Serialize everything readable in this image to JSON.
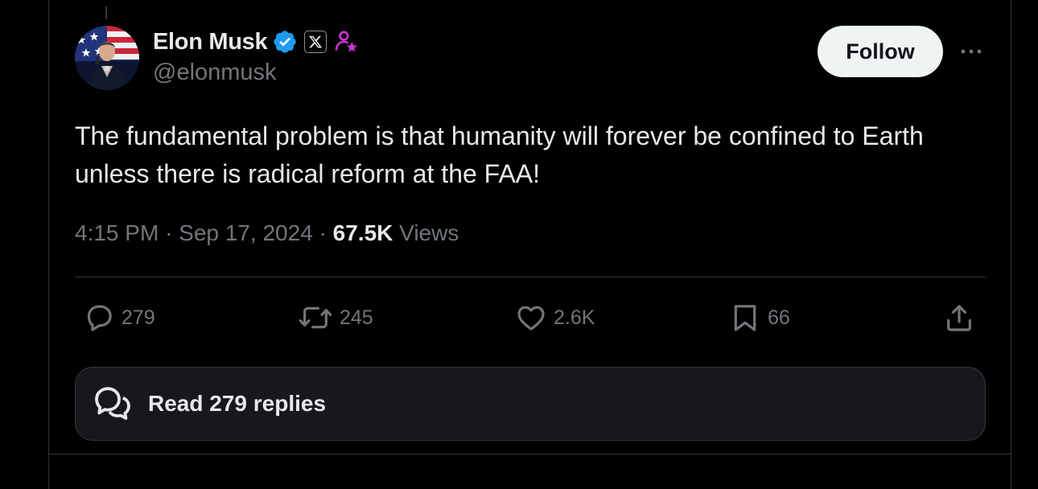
{
  "author": {
    "display_name": "Elon Musk",
    "handle": "@elonmusk",
    "verified": true,
    "verified_color": "#1d9bf0",
    "affiliate_icon": "x-logo-icon",
    "pro_icon_color": "#c936cf"
  },
  "follow_button": {
    "label": "Follow"
  },
  "tweet": {
    "text": "The fundamental problem is that humanity will forever be confined to Earth unless there is radical reform at the FAA!",
    "time": "4:15 PM",
    "date": "Sep 17, 2024",
    "views_count": "67.5K",
    "views_label": "Views",
    "separator": "·"
  },
  "actions": {
    "replies": "279",
    "reposts": "245",
    "likes": "2.6K",
    "bookmarks": "66"
  },
  "read_replies": {
    "label": "Read 279 replies"
  },
  "colors": {
    "background": "#000000",
    "text_primary": "#e7e9ea",
    "text_secondary": "#71767b",
    "border": "#2f3336"
  }
}
